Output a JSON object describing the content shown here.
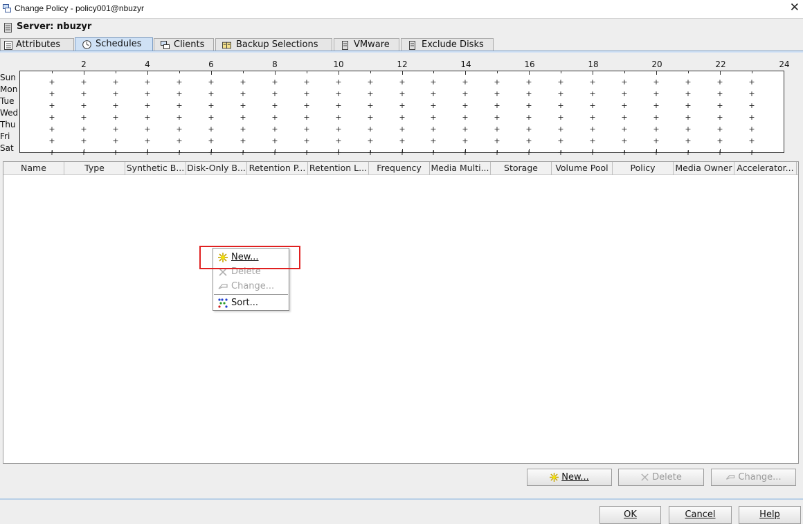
{
  "window": {
    "title": "Change Policy - policy001@nbuzyr",
    "close_glyph": "✕"
  },
  "server": {
    "label": "Server: nbuzyr"
  },
  "tabs": [
    {
      "label": "Attributes",
      "icon": "list-icon"
    },
    {
      "label": "Schedules",
      "icon": "clock-icon",
      "active": true
    },
    {
      "label": "Clients",
      "icon": "computers-icon"
    },
    {
      "label": "Backup Selections",
      "icon": "files-icon"
    },
    {
      "label": "VMware",
      "icon": "database-icon"
    },
    {
      "label": "Exclude Disks",
      "icon": "database-icon"
    }
  ],
  "schedule_grid": {
    "hour_labels": [
      "2",
      "4",
      "6",
      "8",
      "10",
      "12",
      "14",
      "16",
      "18",
      "20",
      "22",
      "24"
    ],
    "days": [
      "Sun",
      "Mon",
      "Tue",
      "Wed",
      "Thu",
      "Fri",
      "Sat"
    ]
  },
  "table": {
    "columns": [
      "Name",
      "Type",
      "Synthetic B...",
      "Disk-Only B...",
      "Retention P...",
      "Retention L...",
      "Frequency",
      "Media Multi...",
      "Storage",
      "Volume Pool",
      "Policy",
      "Media Owner",
      "Accelerator..."
    ],
    "rows": []
  },
  "context_menu": {
    "new_label": "New...",
    "delete_label": "Delete",
    "change_label": "Change...",
    "sort_label": "Sort..."
  },
  "buttons": {
    "new": "New...",
    "delete": "Delete",
    "change": "Change...",
    "ok": "OK",
    "cancel": "Cancel",
    "help": "Help"
  },
  "colors": {
    "active_tab": "#cfe1f5",
    "highlight_box": "#e02020",
    "new_icon": "#e3c000"
  }
}
